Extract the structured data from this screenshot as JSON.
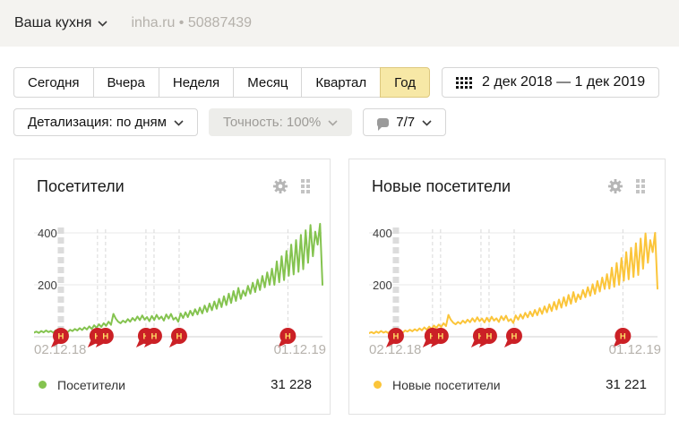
{
  "topbar": {
    "title": "Ваша кухня",
    "site_and_id": "inha.ru • 50887439"
  },
  "toolbar": {
    "periods": [
      "Сегодня",
      "Вчера",
      "Неделя",
      "Месяц",
      "Квартал",
      "Год"
    ],
    "selected_period": "Год",
    "date_range": "2 дек 2018 — 1 дек 2019",
    "detail_label": "Детализация: по дням",
    "accuracy_label": "Точность: 100%",
    "notes_counter": "7/7"
  },
  "cards": [
    {
      "title": "Посетители",
      "legend_label": "Посетители",
      "total": "31 228",
      "dot_color": "#84c34f"
    },
    {
      "title": "Новые посетители",
      "legend_label": "Новые посетители",
      "total": "31 221",
      "dot_color": "#fbc53a"
    }
  ],
  "chart_data": [
    {
      "type": "line",
      "title": "Посетители",
      "x_start_label": "02.12.18",
      "x_end_label": "01.12.19",
      "ylim": [
        0,
        450
      ],
      "y_ticks": [
        200,
        400
      ],
      "grid": true,
      "legend_position": "bottom",
      "total": "31 228",
      "notes": {
        "letter": "Н",
        "color": "#cb2026",
        "positions": [
          0.093,
          0.22,
          0.248,
          0.388,
          0.416,
          0.503,
          0.88
        ],
        "band_index": 0
      },
      "series": [
        {
          "name": "Посетители",
          "color": "#84c34f",
          "values": [
            16,
            20,
            15,
            22,
            17,
            24,
            18,
            22,
            16,
            25,
            19,
            26,
            20,
            24,
            18,
            27,
            22,
            30,
            24,
            33,
            26,
            36,
            28,
            40,
            30,
            44,
            34,
            48,
            38,
            52,
            42,
            58,
            46,
            88,
            70,
            58,
            52,
            62,
            55,
            68,
            58,
            72,
            62,
            78,
            64,
            82,
            66,
            76,
            60,
            80,
            64,
            84,
            68,
            78,
            62,
            86,
            70,
            88,
            66,
            74,
            58,
            90,
            72,
            94,
            76,
            100,
            82,
            106,
            86,
            112,
            90,
            120,
            96,
            128,
            102,
            136,
            108,
            146,
            114,
            156,
            122,
            166,
            130,
            176,
            138,
            188,
            146,
            178,
            158,
            196,
            166,
            208,
            172,
            220,
            180,
            234,
            190,
            248,
            200,
            262,
            200,
            290,
            210,
            310,
            218,
            330,
            235,
            355,
            240,
            372,
            250,
            392,
            260,
            410,
            285,
            430,
            310,
            405,
            355,
            435,
            200
          ]
        }
      ]
    },
    {
      "type": "line",
      "title": "Новые посетители",
      "x_start_label": "02.12.18",
      "x_end_label": "01.12.19",
      "ylim": [
        0,
        450
      ],
      "y_ticks": [
        200,
        400
      ],
      "grid": true,
      "legend_position": "bottom",
      "total": "31 221",
      "notes": {
        "letter": "Н",
        "color": "#cb2026",
        "positions": [
          0.093,
          0.22,
          0.248,
          0.388,
          0.416,
          0.503,
          0.88
        ],
        "band_index": 0
      },
      "series": [
        {
          "name": "Новые посетители",
          "color": "#fbc53a",
          "values": [
            14,
            18,
            13,
            20,
            15,
            22,
            16,
            20,
            14,
            22,
            17,
            23,
            18,
            21,
            16,
            24,
            20,
            27,
            21,
            29,
            23,
            32,
            25,
            36,
            27,
            39,
            30,
            43,
            34,
            47,
            38,
            52,
            41,
            84,
            66,
            54,
            48,
            57,
            50,
            62,
            53,
            66,
            56,
            71,
            58,
            75,
            60,
            70,
            55,
            73,
            58,
            77,
            62,
            71,
            57,
            79,
            64,
            81,
            60,
            68,
            53,
            82,
            66,
            86,
            70,
            92,
            75,
            97,
            79,
            103,
            83,
            110,
            88,
            117,
            94,
            125,
            99,
            134,
            105,
            143,
            112,
            152,
            119,
            161,
            127,
            172,
            134,
            163,
            145,
            180,
            152,
            191,
            158,
            202,
            165,
            215,
            174,
            228,
            184,
            241,
            185,
            266,
            192,
            284,
            200,
            303,
            216,
            326,
            221,
            342,
            230,
            360,
            238,
            378,
            262,
            398,
            285,
            372,
            326,
            400,
            185
          ]
        }
      ]
    }
  ]
}
